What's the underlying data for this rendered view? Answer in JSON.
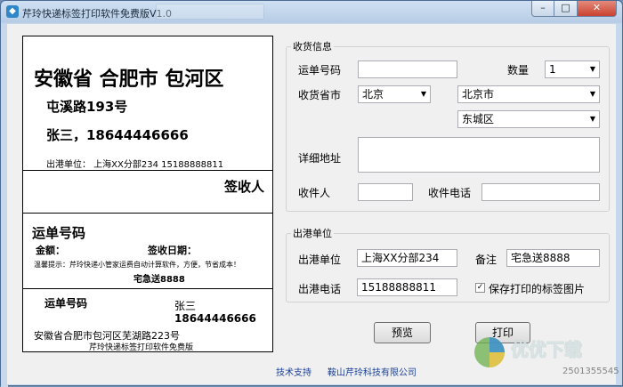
{
  "window": {
    "title": "芹玲快递标签打印软件免费版V1.0",
    "min": "–",
    "max": "□",
    "close": "✕"
  },
  "label": {
    "province_city_district": "安徽省 合肥市 包河区",
    "street": "屯溪路193号",
    "recipient": "张三，18644446666",
    "origin": "出港单位：  上海XX分部234 15188888811",
    "sign_title": "签收人",
    "waybill_title": "运单号码",
    "amount": "金额：",
    "sign_date": "签收日期：",
    "tip": "温馨提示：芹玲快递小管家运费自动计算软件，方便，节省成本！",
    "remark": "宅急送8888",
    "stub_waybill": "运单号码",
    "stub_name": "张三",
    "stub_phone": "18644446666",
    "stub_address": "安徽省合肥市包河区芜湖路223号",
    "stub_footer": "芹玲快递标签打印软件免费版"
  },
  "receive": {
    "legend": "收货信息",
    "waybill_label": "运单号码",
    "waybill_value": "",
    "qty_label": "数量",
    "qty_value": "1",
    "province_label": "收货省市",
    "province_value": "北京",
    "city_value": "北京市",
    "district_value": "东城区",
    "address_label": "详细地址",
    "recipient_label": "收件人",
    "phone_label": "收件电话"
  },
  "outbound": {
    "legend": "出港单位",
    "unit_label": "出港单位",
    "unit_value": "上海XX分部234",
    "remark_label": "备注",
    "remark_value": "宅急送8888",
    "phone_label": "出港电话",
    "phone_value": "15188888811",
    "save_check_label": "保存打印的标签图片",
    "save_checked": "✓"
  },
  "buttons": {
    "preview": "预览",
    "print": "打印"
  },
  "footer": {
    "support": "技术支持",
    "company": "鞍山芹玲科技有限公司"
  },
  "watermark": {
    "brand": "优优下载",
    "qq": "2501355545"
  }
}
